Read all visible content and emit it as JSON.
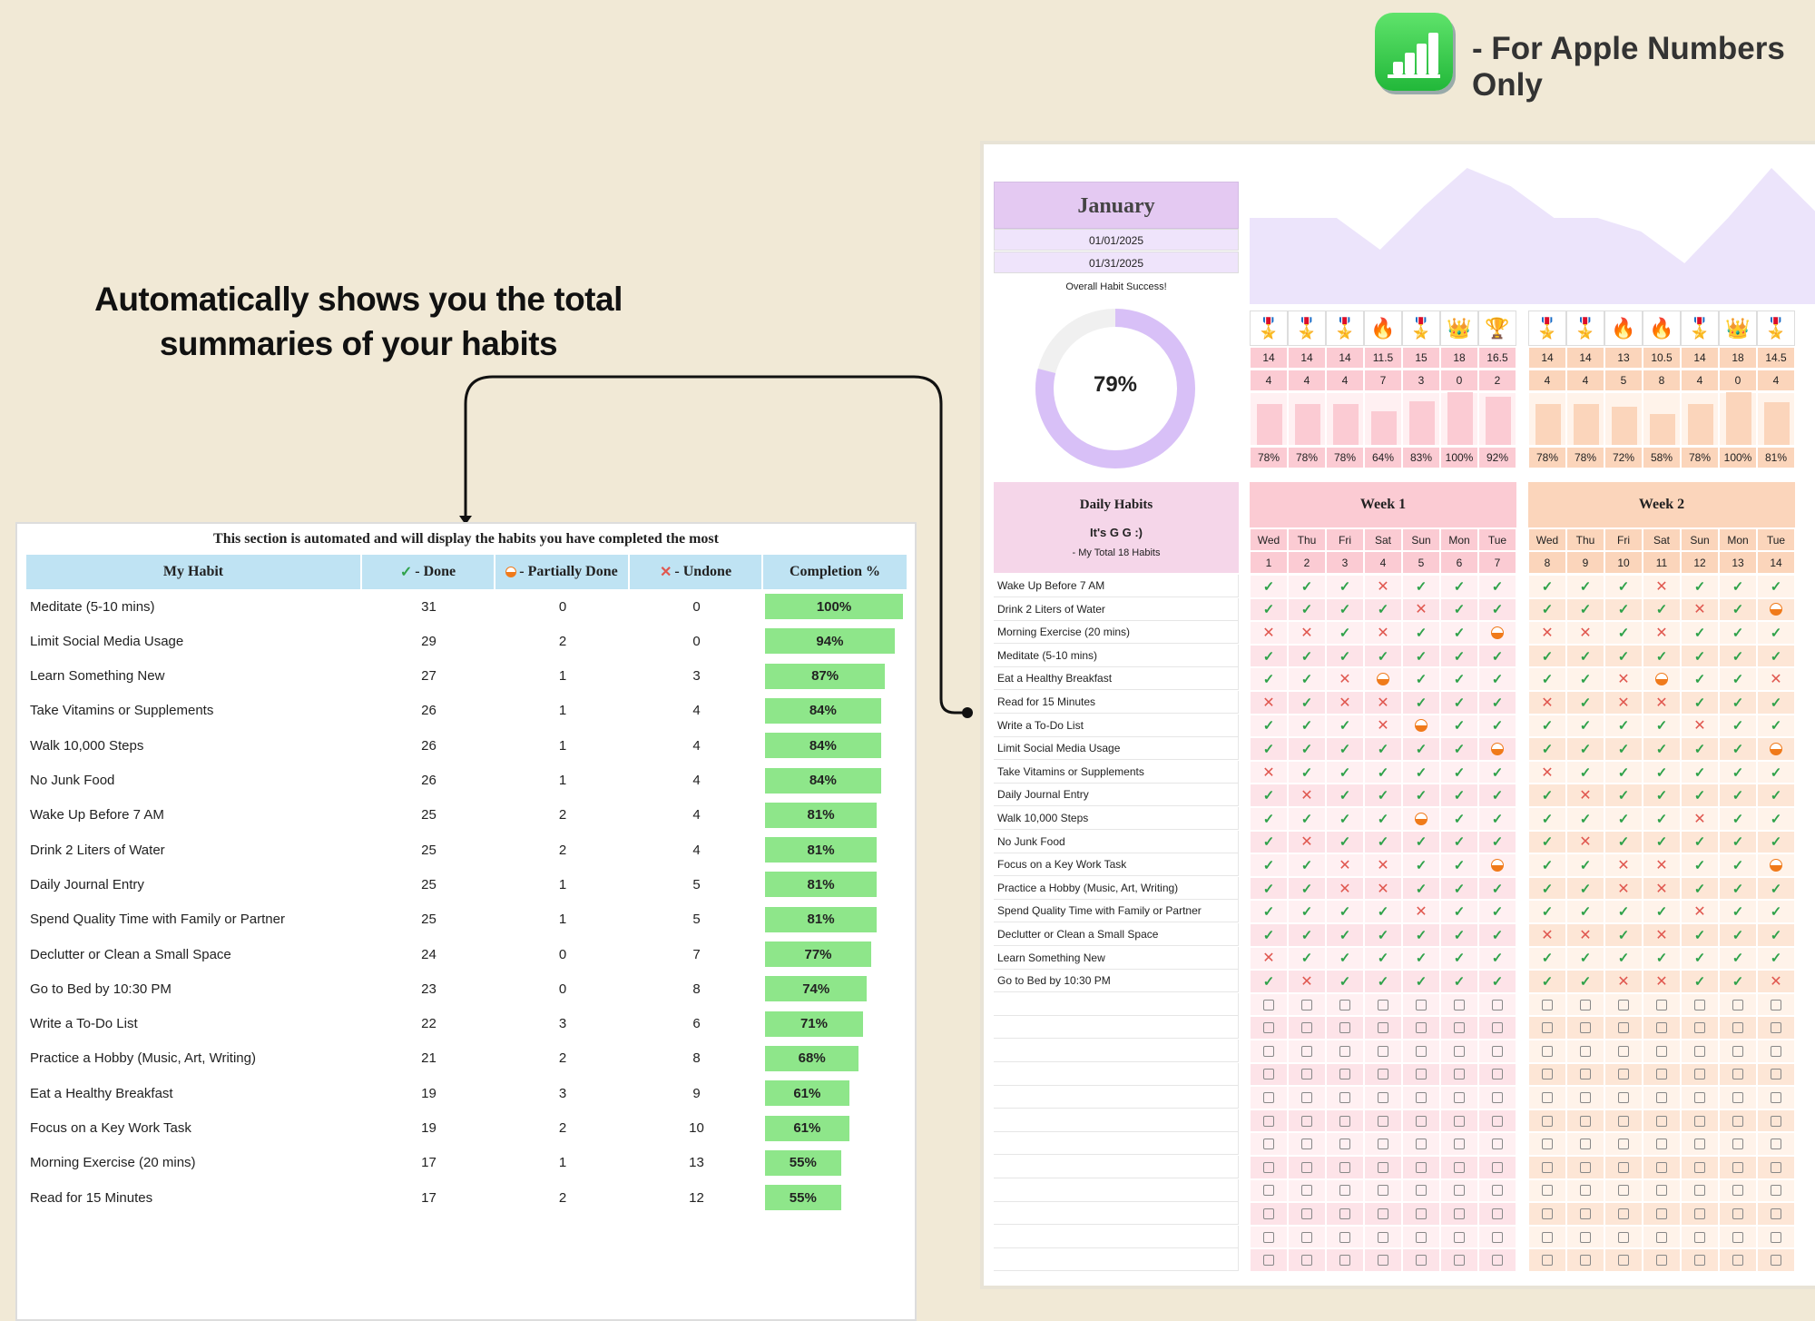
{
  "headline": {
    "line1": "Automatically shows you the total",
    "line2": "summaries of your habits"
  },
  "branding": {
    "note": "- For Apple Numbers Only",
    "logo": "apple-numbers-icon"
  },
  "summary": {
    "title": "This section is automated and will display the habits you have completed the most",
    "headers": {
      "habit": "My Habit",
      "done": "- Done",
      "partial": "- Partially Done",
      "undone": "- Undone",
      "completion": "Completion %"
    },
    "rows": [
      {
        "habit": "Meditate (5-10 mins)",
        "done": 31,
        "partial": 0,
        "undone": 0,
        "pct": "100%"
      },
      {
        "habit": "Limit Social Media Usage",
        "done": 29,
        "partial": 2,
        "undone": 0,
        "pct": "94%"
      },
      {
        "habit": "Learn Something New",
        "done": 27,
        "partial": 1,
        "undone": 3,
        "pct": "87%"
      },
      {
        "habit": "Take Vitamins or Supplements",
        "done": 26,
        "partial": 1,
        "undone": 4,
        "pct": "84%"
      },
      {
        "habit": "Walk 10,000 Steps",
        "done": 26,
        "partial": 1,
        "undone": 4,
        "pct": "84%"
      },
      {
        "habit": "No Junk Food",
        "done": 26,
        "partial": 1,
        "undone": 4,
        "pct": "84%"
      },
      {
        "habit": "Wake Up Before 7 AM",
        "done": 25,
        "partial": 2,
        "undone": 4,
        "pct": "81%"
      },
      {
        "habit": "Drink 2 Liters of Water",
        "done": 25,
        "partial": 2,
        "undone": 4,
        "pct": "81%"
      },
      {
        "habit": "Daily Journal Entry",
        "done": 25,
        "partial": 1,
        "undone": 5,
        "pct": "81%"
      },
      {
        "habit": "Spend Quality Time with Family or Partner",
        "done": 25,
        "partial": 1,
        "undone": 5,
        "pct": "81%"
      },
      {
        "habit": "Declutter or Clean a Small Space",
        "done": 24,
        "partial": 0,
        "undone": 7,
        "pct": "77%"
      },
      {
        "habit": "Go to Bed by 10:30 PM",
        "done": 23,
        "partial": 0,
        "undone": 8,
        "pct": "74%"
      },
      {
        "habit": "Write a To-Do List",
        "done": 22,
        "partial": 3,
        "undone": 6,
        "pct": "71%"
      },
      {
        "habit": "Practice a Hobby (Music, Art, Writing)",
        "done": 21,
        "partial": 2,
        "undone": 8,
        "pct": "68%"
      },
      {
        "habit": "Eat a Healthy Breakfast",
        "done": 19,
        "partial": 3,
        "undone": 9,
        "pct": "61%"
      },
      {
        "habit": "Focus on a Key Work Task",
        "done": 19,
        "partial": 2,
        "undone": 10,
        "pct": "61%"
      },
      {
        "habit": "Morning Exercise (20 mins)",
        "done": 17,
        "partial": 1,
        "undone": 13,
        "pct": "55%"
      },
      {
        "habit": "Read for 15 Minutes",
        "done": 17,
        "partial": 2,
        "undone": 12,
        "pct": "55%"
      }
    ]
  },
  "tracker": {
    "month": "January",
    "start_date": "01/01/2025",
    "end_date": "01/31/2025",
    "success_label": "Overall Habit Success!",
    "overall_pct": "79%",
    "overall_value": 79,
    "colors": {
      "donut": "#d8c0f7",
      "week1": "#fbcbd3",
      "week2": "#fbd5bb",
      "area": "#ece4fb"
    },
    "daily_header": {
      "title": "Daily Habits",
      "subtitle": "It's G G :)",
      "total": "- My Total 18 Habits"
    },
    "habits": [
      "Wake Up Before 7 AM",
      "Drink 2 Liters of Water",
      "Morning Exercise (20 mins)",
      "Meditate (5-10 mins)",
      "Eat a Healthy Breakfast",
      "Read for 15 Minutes",
      "Write a To-Do List",
      "Limit Social Media Usage",
      "Take Vitamins or Supplements",
      "Daily Journal Entry",
      "Walk 10,000 Steps",
      "No Junk Food",
      "Focus on a Key Work Task",
      "Practice a Hobby (Music, Art, Writing)",
      "Spend Quality Time with Family or Partner",
      "Declutter or Clean a Small Space",
      "Learn Something New",
      "Go to Bed by 10:30 PM"
    ],
    "weeks": [
      {
        "label": "Week 1",
        "days": [
          "Wed",
          "Thu",
          "Fri",
          "Sat",
          "Sun",
          "Mon",
          "Tue"
        ],
        "dates": [
          "1",
          "2",
          "3",
          "4",
          "5",
          "6",
          "7"
        ],
        "icons": [
          "🎖️",
          "🎖️",
          "🎖️",
          "🔥",
          "🎖️",
          "👑",
          "🏆"
        ],
        "done": [
          "14",
          "14",
          "14",
          "11.5",
          "15",
          "18",
          "16.5"
        ],
        "undone": [
          "4",
          "4",
          "4",
          "7",
          "3",
          "0",
          "2"
        ],
        "pct": [
          "78%",
          "78%",
          "78%",
          "64%",
          "83%",
          "100%",
          "92%"
        ],
        "pct_values": [
          78,
          78,
          78,
          64,
          83,
          100,
          92
        ],
        "grid": [
          "vvvxvvv",
          "vvvvxvv",
          "xxvxvvp",
          "vvvvvvv",
          "vvxpvvv",
          "xvxxvvv",
          "vvvxpvv",
          "vvvvvvp",
          "xvvvvvv",
          "vxvvvvv",
          "vvvvpvv",
          "vxvvvvv",
          "vvxxvvp",
          "vvxxvvv",
          "vvvvxvv",
          "vvvvvvv",
          "xvvvvvv",
          "vxvvvvv"
        ]
      },
      {
        "label": "Week 2",
        "days": [
          "Wed",
          "Thu",
          "Fri",
          "Sat",
          "Sun",
          "Mon",
          "Tue"
        ],
        "dates": [
          "8",
          "9",
          "10",
          "11",
          "12",
          "13",
          "14"
        ],
        "icons": [
          "🎖️",
          "🎖️",
          "🔥",
          "🔥",
          "🎖️",
          "👑",
          "🎖️"
        ],
        "done": [
          "14",
          "14",
          "13",
          "10.5",
          "14",
          "18",
          "14.5"
        ],
        "undone": [
          "4",
          "4",
          "5",
          "8",
          "4",
          "0",
          "4"
        ],
        "pct": [
          "78%",
          "78%",
          "72%",
          "58%",
          "78%",
          "100%",
          "81%"
        ],
        "pct_values": [
          78,
          78,
          72,
          58,
          78,
          100,
          81
        ],
        "grid": [
          "vvvxvvv",
          "vvvvxvp",
          "xxvxvvv",
          "vvvvvvv",
          "vvxpvvx",
          "xvxxvvv",
          "vvvvxvv",
          "vvvvvvp",
          "xvvvvvv",
          "vxvvvvv",
          "vvvvxvv",
          "vxvvvvv",
          "vvxxvvp",
          "vvxxvvv",
          "vvvvxvv",
          "xxvxvvv",
          "vvvvvvv",
          "vvxxvvx"
        ]
      }
    ]
  }
}
